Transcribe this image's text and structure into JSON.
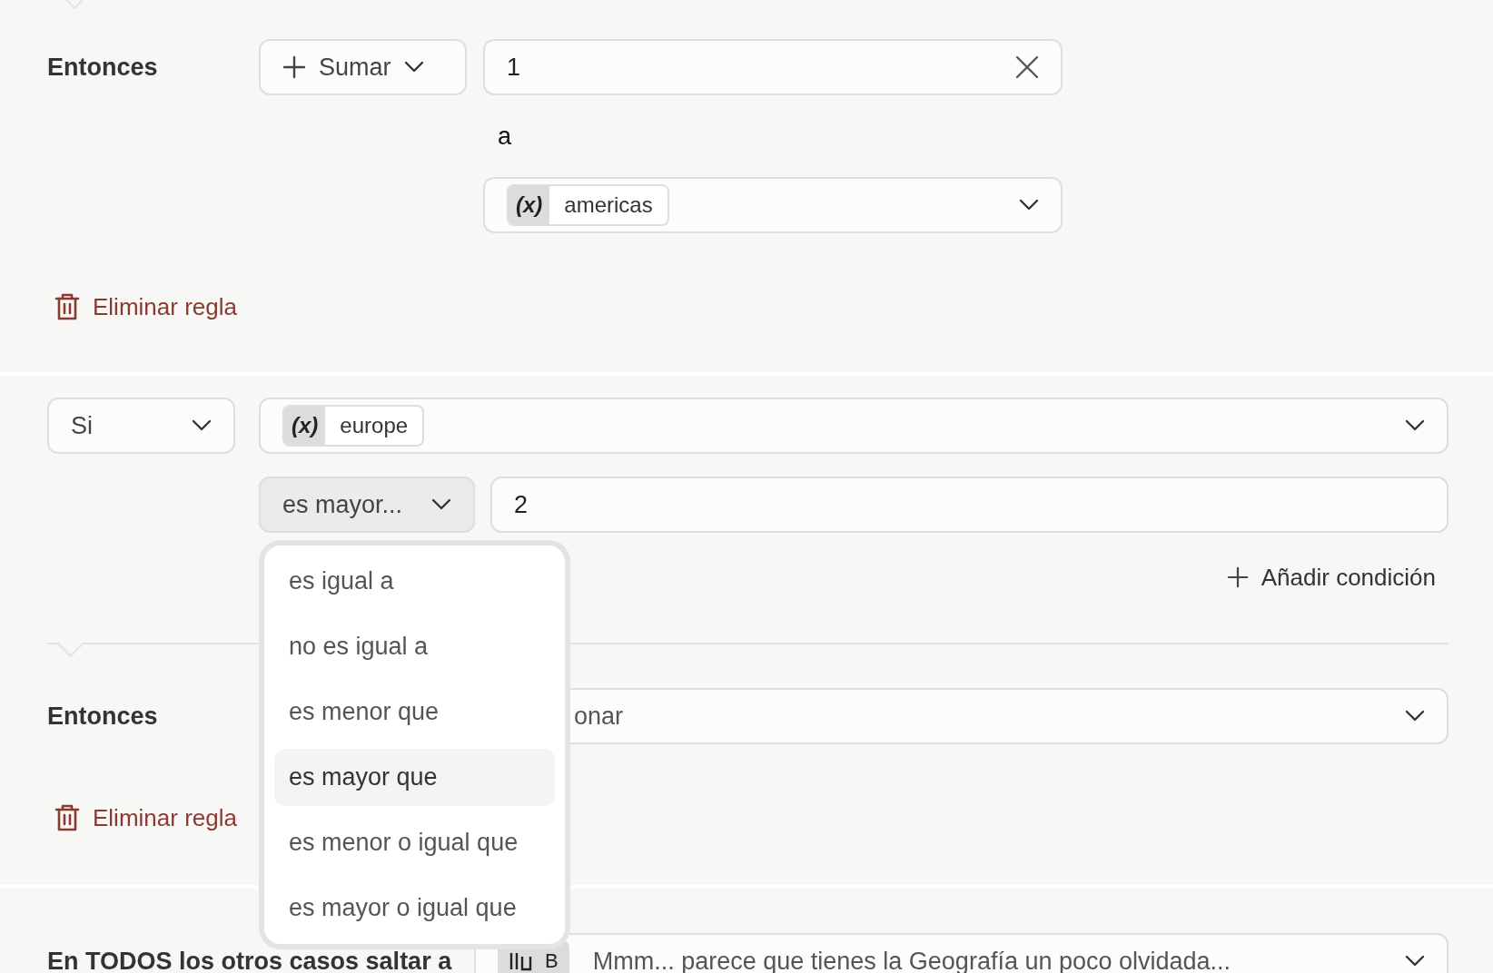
{
  "rule_1": {
    "then_label": "Entonces",
    "action": {
      "label": "Sumar"
    },
    "value": "1",
    "connector": "a",
    "target": {
      "chip_icon": "(x)",
      "chip_label": "americas"
    },
    "delete_label": "Eliminar regla"
  },
  "rule_2": {
    "condition_mode": "Si",
    "variable": {
      "chip_icon": "(x)",
      "chip_label": "europe"
    },
    "operator": {
      "label": "es mayor...",
      "expanded": true
    },
    "value": "2",
    "add_condition": "Añadir condición",
    "then_label": "Entonces",
    "action_placeholder": "onar",
    "delete_label": "Eliminar regla"
  },
  "operator_menu": {
    "items": [
      {
        "label": "es igual a",
        "selected": false
      },
      {
        "label": "no es igual a",
        "selected": false
      },
      {
        "label": "es menor que",
        "selected": false
      },
      {
        "label": "es mayor que",
        "selected": true
      },
      {
        "label": "es menor o igual que",
        "selected": false
      },
      {
        "label": "es mayor o igual que",
        "selected": false
      }
    ]
  },
  "fallback": {
    "label": "En TODOS los otros casos saltar a",
    "target_letter": "B",
    "target_text": "Mmm... parece que tienes la Geografía un poco olvidada..."
  }
}
